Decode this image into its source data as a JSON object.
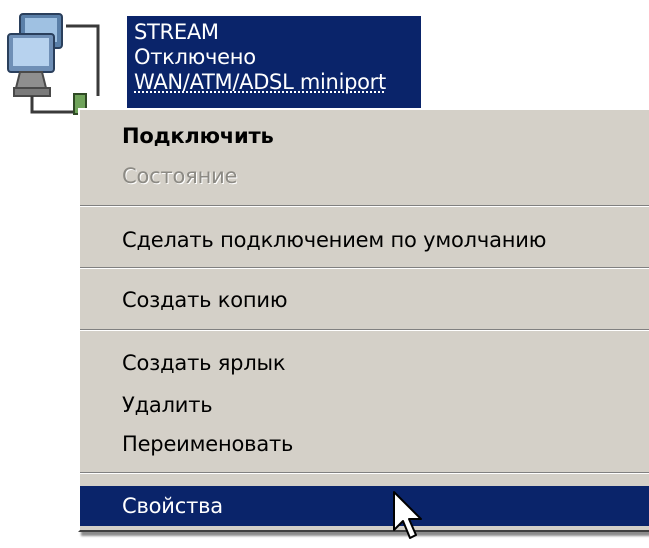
{
  "connection": {
    "name": "STREAM",
    "status": "Отключено",
    "device": "WAN/ATM/ADSL miniport"
  },
  "icons": {
    "connection_icon": "network-connection-icon",
    "cursor": "arrow-cursor-icon"
  },
  "colors": {
    "selection": "#0a246a",
    "menu_background": "#d4d0c8",
    "disabled_text": "#8c8a84"
  },
  "context_menu": {
    "connect": "Подключить",
    "status": "Состояние",
    "set_default": "Сделать подключением по умолчанию",
    "create_copy": "Создать копию",
    "create_shortcut": "Создать ярлык",
    "delete": "Удалить",
    "rename": "Переименовать",
    "properties": "Свойства"
  }
}
